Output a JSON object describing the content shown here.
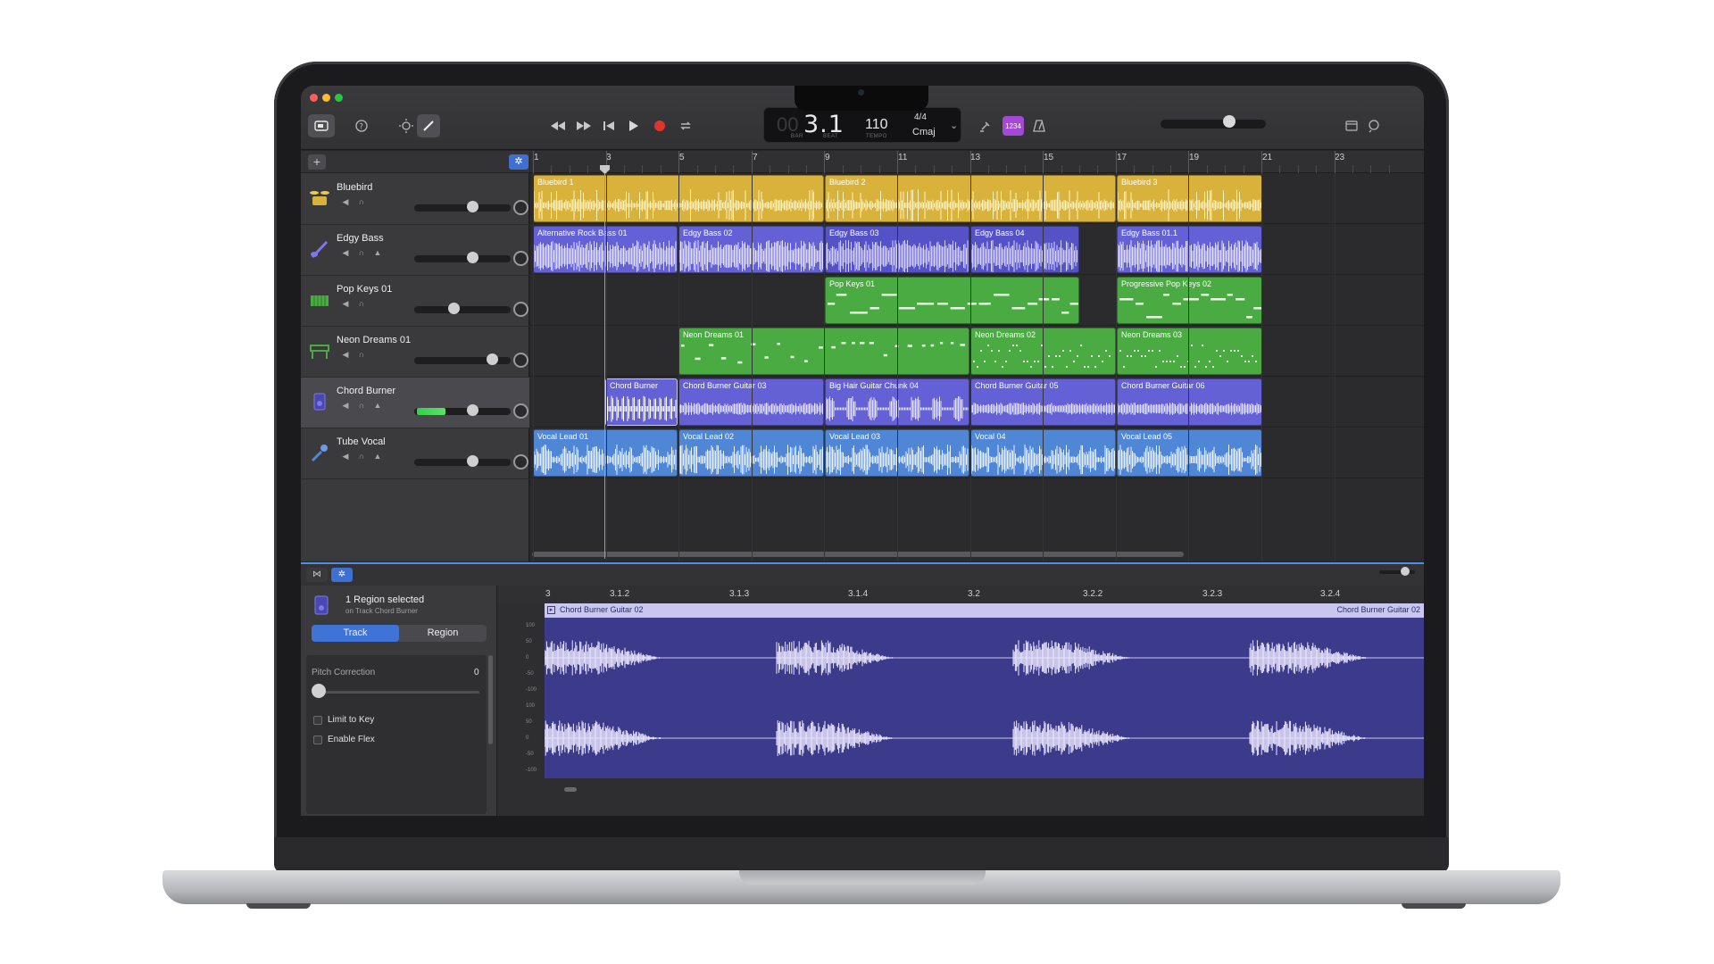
{
  "app": {
    "lcd": {
      "bar_beat": "3.1",
      "dim_digits": "00",
      "bar_label": "BAR",
      "beat_label": "BEAT",
      "tempo": "110",
      "tempo_label": "TEMPO",
      "signature": "4/4",
      "key": "Cmaj"
    },
    "count_in_badge": "1234"
  },
  "headers": {
    "add_label": "+",
    "tracks": [
      {
        "name": "Bluebird",
        "icon": "drum-kit-icon",
        "color": "#d8b23a"
      },
      {
        "name": "Edgy Bass",
        "icon": "bass-guitar-icon",
        "color": "#6d6ae0"
      },
      {
        "name": "Pop Keys 01",
        "icon": "keyboard-icon",
        "color": "#48b048"
      },
      {
        "name": "Neon Dreams 01",
        "icon": "synth-icon",
        "color": "#48b048"
      },
      {
        "name": "Chord Burner",
        "icon": "amp-icon",
        "color": "#6d6ae0"
      },
      {
        "name": "Tube Vocal",
        "icon": "microphone-icon",
        "color": "#4f86d6"
      }
    ]
  },
  "ruler": {
    "bars": [
      "1",
      "3",
      "5",
      "7",
      "9",
      "11",
      "13",
      "15",
      "17",
      "19",
      "21",
      "23"
    ]
  },
  "regions": {
    "bluebird": [
      "Bluebird 1",
      "Bluebird 2",
      "Bluebird 3"
    ],
    "bass": [
      "Alternative Rock Bass 01",
      "Edgy Bass 02",
      "Edgy Bass 03",
      "Edgy Bass 04",
      "Edgy Bass 01.1"
    ],
    "keys": [
      "Pop Keys 01",
      "Progressive Pop Keys 02"
    ],
    "neon": [
      "Neon Dreams 01",
      "Neon Dreams 02",
      "Neon Dreams 03"
    ],
    "chord": [
      "Chord Burner",
      "Chord Burner Guitar 03",
      "Big Hair Guitar Chunk 04",
      "Chord Burner Guitar 05",
      "Chord Burner Guitar 06"
    ],
    "vocal": [
      "Vocal Lead 01",
      "Vocal Lead 02",
      "Vocal Lead 03",
      "Vocal 04",
      "Vocal Lead 05"
    ]
  },
  "colors": {
    "yellow": "#d8b23a",
    "purple": "#6d6ae0",
    "green": "#4bab43",
    "blue": "#4f86d6",
    "wave_light": "#ece8ff"
  },
  "editor": {
    "selection_title": "1 Region selected",
    "selection_sub": "on Track Chord Burner",
    "tab_track": "Track",
    "tab_region": "Region",
    "pitch_correction_label": "Pitch Correction",
    "pitch_correction_value": "0",
    "limit_to_key": "Limit to Key",
    "enable_flex": "Enable Flex",
    "ruler": [
      "3",
      "3.1.2",
      "3.1.3",
      "3.1.4",
      "3.2",
      "3.2.2",
      "3.2.3",
      "3.2.4"
    ],
    "region_name": "Chord Burner Guitar 02",
    "db_labels": [
      "100",
      "50",
      "0",
      "-50",
      "-100",
      "100",
      "50",
      "0",
      "-50",
      "-100"
    ]
  }
}
